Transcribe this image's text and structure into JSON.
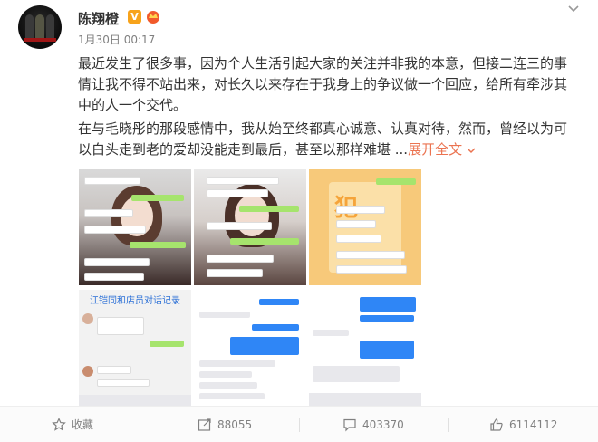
{
  "post": {
    "author": "陈翔橙",
    "badge": "V",
    "time": "1月30日 00:17",
    "paragraph1": "最近发生了很多事，因为个人生活引起大家的关注并非我的本意，但接二连三的事情让我不得不站出来，对长久以来存在于我身上的争议做一个回应，给所有牵涉其中的人一个交代。",
    "paragraph2": "在与毛晓彤的那段感情中，我从始至终都真心诚意、认真对待，然而，曾经以为可以白头走到老的爱却没能走到最后，甚至以那样难堪 ...",
    "more": "展开全文",
    "more_icon": "chevron-down-icon"
  },
  "images": [
    {
      "caption": ""
    },
    {
      "caption": ""
    },
    {
      "caption": "犯"
    },
    {
      "caption": "江铠同和店员对话记录"
    },
    {
      "caption": ""
    },
    {
      "caption": ""
    }
  ],
  "actions": {
    "favorite": "收藏",
    "repost": "88055",
    "comment": "403370",
    "like": "6114112"
  },
  "colors": {
    "accent": "#eb7350",
    "badge": "#f7a31b",
    "text": "#333333",
    "muted": "#808080"
  }
}
